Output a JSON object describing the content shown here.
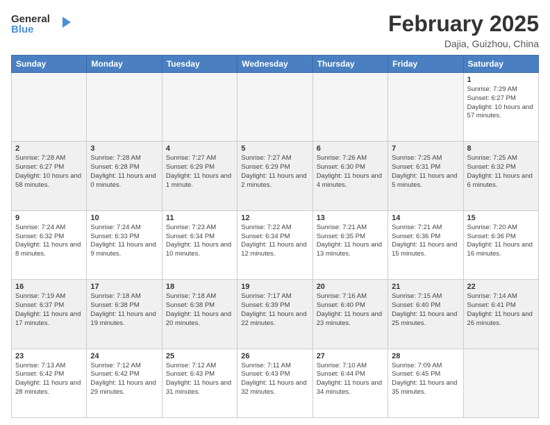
{
  "header": {
    "logo_general": "General",
    "logo_blue": "Blue",
    "month": "February 2025",
    "location": "Dajia, Guizhou, China"
  },
  "weekdays": [
    "Sunday",
    "Monday",
    "Tuesday",
    "Wednesday",
    "Thursday",
    "Friday",
    "Saturday"
  ],
  "weeks": [
    [
      {
        "day": "",
        "info": ""
      },
      {
        "day": "",
        "info": ""
      },
      {
        "day": "",
        "info": ""
      },
      {
        "day": "",
        "info": ""
      },
      {
        "day": "",
        "info": ""
      },
      {
        "day": "",
        "info": ""
      },
      {
        "day": "1",
        "info": "Sunrise: 7:29 AM\nSunset: 6:27 PM\nDaylight: 10 hours and 57 minutes."
      }
    ],
    [
      {
        "day": "2",
        "info": "Sunrise: 7:28 AM\nSunset: 6:27 PM\nDaylight: 10 hours and 58 minutes."
      },
      {
        "day": "3",
        "info": "Sunrise: 7:28 AM\nSunset: 6:28 PM\nDaylight: 11 hours and 0 minutes."
      },
      {
        "day": "4",
        "info": "Sunrise: 7:27 AM\nSunset: 6:29 PM\nDaylight: 11 hours and 1 minute."
      },
      {
        "day": "5",
        "info": "Sunrise: 7:27 AM\nSunset: 6:29 PM\nDaylight: 11 hours and 2 minutes."
      },
      {
        "day": "6",
        "info": "Sunrise: 7:26 AM\nSunset: 6:30 PM\nDaylight: 11 hours and 4 minutes."
      },
      {
        "day": "7",
        "info": "Sunrise: 7:25 AM\nSunset: 6:31 PM\nDaylight: 11 hours and 5 minutes."
      },
      {
        "day": "8",
        "info": "Sunrise: 7:25 AM\nSunset: 6:32 PM\nDaylight: 11 hours and 6 minutes."
      }
    ],
    [
      {
        "day": "9",
        "info": "Sunrise: 7:24 AM\nSunset: 6:32 PM\nDaylight: 11 hours and 8 minutes."
      },
      {
        "day": "10",
        "info": "Sunrise: 7:24 AM\nSunset: 6:33 PM\nDaylight: 11 hours and 9 minutes."
      },
      {
        "day": "11",
        "info": "Sunrise: 7:23 AM\nSunset: 6:34 PM\nDaylight: 11 hours and 10 minutes."
      },
      {
        "day": "12",
        "info": "Sunrise: 7:22 AM\nSunset: 6:34 PM\nDaylight: 11 hours and 12 minutes."
      },
      {
        "day": "13",
        "info": "Sunrise: 7:21 AM\nSunset: 6:35 PM\nDaylight: 11 hours and 13 minutes."
      },
      {
        "day": "14",
        "info": "Sunrise: 7:21 AM\nSunset: 6:36 PM\nDaylight: 11 hours and 15 minutes."
      },
      {
        "day": "15",
        "info": "Sunrise: 7:20 AM\nSunset: 6:36 PM\nDaylight: 11 hours and 16 minutes."
      }
    ],
    [
      {
        "day": "16",
        "info": "Sunrise: 7:19 AM\nSunset: 6:37 PM\nDaylight: 11 hours and 17 minutes."
      },
      {
        "day": "17",
        "info": "Sunrise: 7:18 AM\nSunset: 6:38 PM\nDaylight: 11 hours and 19 minutes."
      },
      {
        "day": "18",
        "info": "Sunrise: 7:18 AM\nSunset: 6:38 PM\nDaylight: 11 hours and 20 minutes."
      },
      {
        "day": "19",
        "info": "Sunrise: 7:17 AM\nSunset: 6:39 PM\nDaylight: 11 hours and 22 minutes."
      },
      {
        "day": "20",
        "info": "Sunrise: 7:16 AM\nSunset: 6:40 PM\nDaylight: 11 hours and 23 minutes."
      },
      {
        "day": "21",
        "info": "Sunrise: 7:15 AM\nSunset: 6:40 PM\nDaylight: 11 hours and 25 minutes."
      },
      {
        "day": "22",
        "info": "Sunrise: 7:14 AM\nSunset: 6:41 PM\nDaylight: 11 hours and 26 minutes."
      }
    ],
    [
      {
        "day": "23",
        "info": "Sunrise: 7:13 AM\nSunset: 6:42 PM\nDaylight: 11 hours and 28 minutes."
      },
      {
        "day": "24",
        "info": "Sunrise: 7:12 AM\nSunset: 6:42 PM\nDaylight: 11 hours and 29 minutes."
      },
      {
        "day": "25",
        "info": "Sunrise: 7:12 AM\nSunset: 6:43 PM\nDaylight: 11 hours and 31 minutes."
      },
      {
        "day": "26",
        "info": "Sunrise: 7:11 AM\nSunset: 6:43 PM\nDaylight: 11 hours and 32 minutes."
      },
      {
        "day": "27",
        "info": "Sunrise: 7:10 AM\nSunset: 6:44 PM\nDaylight: 11 hours and 34 minutes."
      },
      {
        "day": "28",
        "info": "Sunrise: 7:09 AM\nSunset: 6:45 PM\nDaylight: 11 hours and 35 minutes."
      },
      {
        "day": "",
        "info": ""
      }
    ]
  ]
}
